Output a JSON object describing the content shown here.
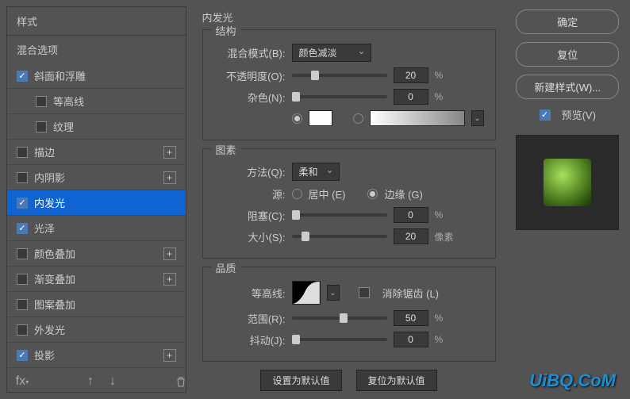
{
  "sidebar": {
    "header": "样式",
    "subheader": "混合选项",
    "items": [
      {
        "label": "斜面和浮雕",
        "checked": true,
        "plus": false
      },
      {
        "label": "等高线",
        "checked": false,
        "plus": false,
        "indent": true
      },
      {
        "label": "纹理",
        "checked": false,
        "plus": false,
        "indent": true
      },
      {
        "label": "描边",
        "checked": false,
        "plus": true
      },
      {
        "label": "内阴影",
        "checked": false,
        "plus": true
      },
      {
        "label": "内发光",
        "checked": true,
        "plus": false,
        "selected": true
      },
      {
        "label": "光泽",
        "checked": true,
        "plus": false
      },
      {
        "label": "颜色叠加",
        "checked": false,
        "plus": true
      },
      {
        "label": "渐变叠加",
        "checked": false,
        "plus": true
      },
      {
        "label": "图案叠加",
        "checked": false,
        "plus": false
      },
      {
        "label": "外发光",
        "checked": false,
        "plus": false
      },
      {
        "label": "投影",
        "checked": true,
        "plus": true
      }
    ]
  },
  "main": {
    "title": "内发光",
    "structure": {
      "legend": "结构",
      "blend_mode_label": "混合模式(B):",
      "blend_mode_value": "颜色减淡",
      "opacity_label": "不透明度(O):",
      "opacity_value": "20",
      "noise_label": "杂色(N):",
      "noise_value": "0",
      "percent": "%"
    },
    "elements": {
      "legend": "图素",
      "method_label": "方法(Q):",
      "method_value": "柔和",
      "source_label": "源:",
      "source_center": "居中 (E)",
      "source_edge": "边缘 (G)",
      "choke_label": "阻塞(C):",
      "choke_value": "0",
      "size_label": "大小(S):",
      "size_value": "20",
      "px": "像素",
      "percent": "%"
    },
    "quality": {
      "legend": "品质",
      "contour_label": "等高线:",
      "antialias_label": "消除锯齿 (L)",
      "range_label": "范围(R):",
      "range_value": "50",
      "jitter_label": "抖动(J):",
      "jitter_value": "0",
      "percent": "%"
    },
    "buttons": {
      "set_default": "设置为默认值",
      "reset_default": "复位为默认值"
    }
  },
  "right": {
    "ok": "确定",
    "reset": "复位",
    "new_style": "新建样式(W)...",
    "preview_label": "预览(V)"
  },
  "watermark": "UiBQ.CoM"
}
